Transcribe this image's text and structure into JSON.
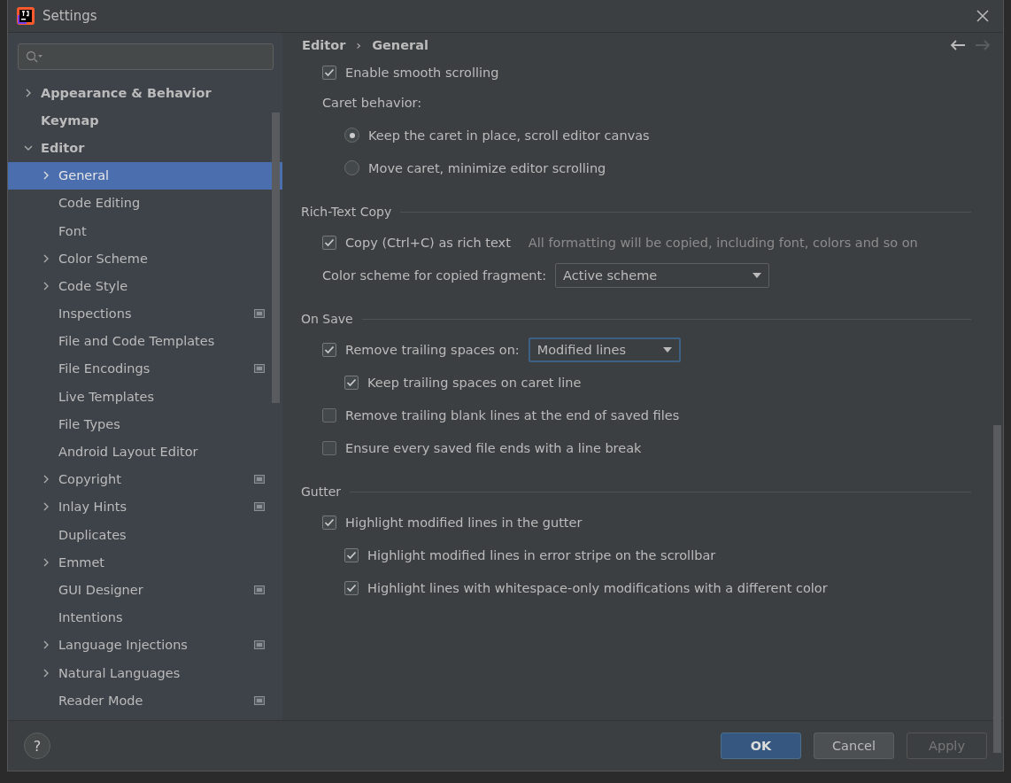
{
  "window": {
    "title": "Settings"
  },
  "sidebar": {
    "items": [
      {
        "label": "Appearance & Behavior",
        "kind": "group",
        "expanded": false,
        "selected": false,
        "project_scope": false
      },
      {
        "label": "Keymap",
        "kind": "leaf",
        "selected": false,
        "project_scope": false
      },
      {
        "label": "Editor",
        "kind": "group",
        "expanded": true,
        "selected": false,
        "project_scope": false,
        "children": [
          {
            "label": "General",
            "kind": "group",
            "expanded": false,
            "selected": true,
            "project_scope": false
          },
          {
            "label": "Code Editing",
            "kind": "leaf",
            "selected": false,
            "project_scope": false
          },
          {
            "label": "Font",
            "kind": "leaf",
            "selected": false,
            "project_scope": false
          },
          {
            "label": "Color Scheme",
            "kind": "group",
            "expanded": false,
            "selected": false,
            "project_scope": false
          },
          {
            "label": "Code Style",
            "kind": "group",
            "expanded": false,
            "selected": false,
            "project_scope": false
          },
          {
            "label": "Inspections",
            "kind": "leaf",
            "selected": false,
            "project_scope": true
          },
          {
            "label": "File and Code Templates",
            "kind": "leaf",
            "selected": false,
            "project_scope": false
          },
          {
            "label": "File Encodings",
            "kind": "leaf",
            "selected": false,
            "project_scope": true
          },
          {
            "label": "Live Templates",
            "kind": "leaf",
            "selected": false,
            "project_scope": false
          },
          {
            "label": "File Types",
            "kind": "leaf",
            "selected": false,
            "project_scope": false
          },
          {
            "label": "Android Layout Editor",
            "kind": "leaf",
            "selected": false,
            "project_scope": false
          },
          {
            "label": "Copyright",
            "kind": "group",
            "expanded": false,
            "selected": false,
            "project_scope": true
          },
          {
            "label": "Inlay Hints",
            "kind": "group",
            "expanded": false,
            "selected": false,
            "project_scope": true
          },
          {
            "label": "Duplicates",
            "kind": "leaf",
            "selected": false,
            "project_scope": false
          },
          {
            "label": "Emmet",
            "kind": "group",
            "expanded": false,
            "selected": false,
            "project_scope": false
          },
          {
            "label": "GUI Designer",
            "kind": "leaf",
            "selected": false,
            "project_scope": true
          },
          {
            "label": "Intentions",
            "kind": "leaf",
            "selected": false,
            "project_scope": false
          },
          {
            "label": "Language Injections",
            "kind": "group",
            "expanded": false,
            "selected": false,
            "project_scope": true
          },
          {
            "label": "Natural Languages",
            "kind": "group",
            "expanded": false,
            "selected": false,
            "project_scope": false
          },
          {
            "label": "Reader Mode",
            "kind": "leaf",
            "selected": false,
            "project_scope": true
          }
        ]
      }
    ]
  },
  "breadcrumb": [
    "Editor",
    "General"
  ],
  "breadcrumb_separator": "›",
  "nav": {
    "back_enabled": true,
    "forward_enabled": false
  },
  "sections": [
    {
      "rows": [
        {
          "kind": "checkbox",
          "label": "Enable smooth scrolling",
          "checked": true
        },
        {
          "kind": "label",
          "label": "Caret behavior:",
          "children": [
            {
              "kind": "radio",
              "label": "Keep the caret in place, scroll editor canvas",
              "selected": true
            },
            {
              "kind": "radio",
              "label": "Move caret, minimize editor scrolling",
              "selected": false
            }
          ]
        }
      ]
    },
    {
      "title": "Rich-Text Copy",
      "rows": [
        {
          "kind": "checkbox",
          "label": "Copy (Ctrl+C) as rich text",
          "checked": true,
          "hint": "All formatting will be copied, including font, colors and so on"
        },
        {
          "kind": "dropdown",
          "label": "Color scheme for copied fragment:",
          "value": "Active scheme",
          "focused": false
        }
      ]
    },
    {
      "title": "On Save",
      "rows": [
        {
          "kind": "checkbox",
          "label": "Remove trailing spaces on:",
          "checked": true,
          "dropdown": {
            "value": "Modified lines",
            "focused": true
          },
          "children": [
            {
              "kind": "checkbox",
              "label": "Keep trailing spaces on caret line",
              "checked": true
            }
          ]
        },
        {
          "kind": "checkbox",
          "label": "Remove trailing blank lines at the end of saved files",
          "checked": false
        },
        {
          "kind": "checkbox",
          "label": "Ensure every saved file ends with a line break",
          "checked": false
        }
      ]
    },
    {
      "title": "Gutter",
      "rows": [
        {
          "kind": "checkbox",
          "label": "Highlight modified lines in the gutter",
          "checked": true,
          "children": [
            {
              "kind": "checkbox",
              "label": "Highlight modified lines in error stripe on the scrollbar",
              "checked": true
            },
            {
              "kind": "checkbox",
              "label": "Highlight lines with whitespace-only modifications with a different color",
              "checked": true
            }
          ]
        }
      ]
    }
  ],
  "help": "?",
  "buttons": [
    {
      "label": "OK",
      "kind": "primary",
      "disabled": false
    },
    {
      "label": "Cancel",
      "kind": "normal",
      "disabled": false
    },
    {
      "label": "Apply",
      "kind": "normal",
      "disabled": true
    }
  ]
}
